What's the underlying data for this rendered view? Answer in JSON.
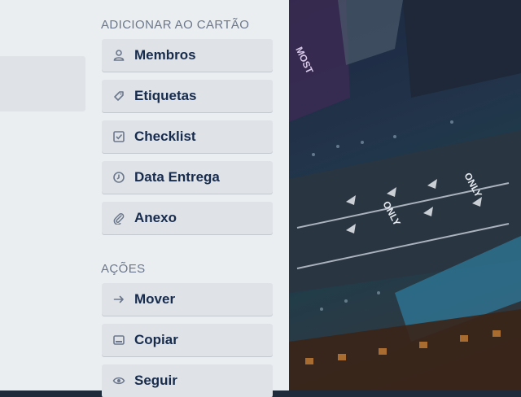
{
  "sections": {
    "add_to_card": {
      "title": "ADICIONAR AO CARTÃO",
      "items": [
        {
          "label": "Membros",
          "icon": "person-icon"
        },
        {
          "label": "Etiquetas",
          "icon": "tag-icon"
        },
        {
          "label": "Checklist",
          "icon": "checkbox-icon"
        },
        {
          "label": "Data Entrega",
          "icon": "clock-icon"
        },
        {
          "label": "Anexo",
          "icon": "paperclip-icon"
        }
      ]
    },
    "actions": {
      "title": "AÇÕES",
      "items": [
        {
          "label": "Mover",
          "icon": "arrow-right-icon"
        },
        {
          "label": "Copiar",
          "icon": "card-copy-icon"
        },
        {
          "label": "Seguir",
          "icon": "eye-icon"
        }
      ]
    }
  },
  "background_photo": {
    "signs": [
      "MOST",
      "ONLY",
      "ONLY"
    ]
  },
  "colors": {
    "panel_bg": "#ebeef1",
    "button_bg": "#dfe3e7",
    "text": "#172b4d",
    "muted": "#6b778c"
  }
}
